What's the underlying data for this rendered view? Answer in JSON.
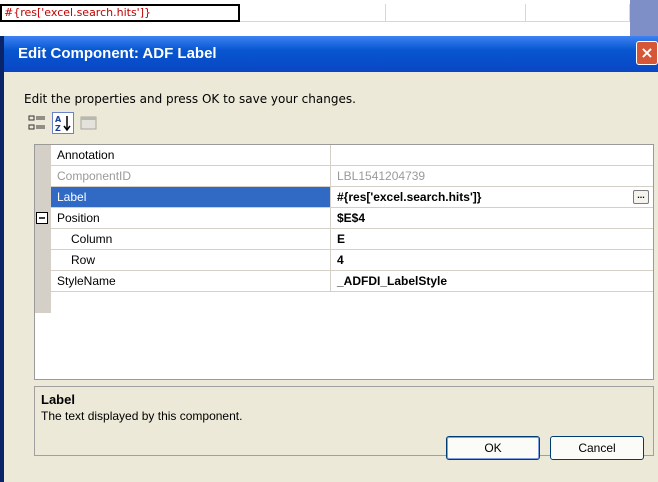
{
  "spreadsheet": {
    "active_cell_text": "#{res['excel.search.hits']}"
  },
  "dialog": {
    "title": "Edit Component: ADF Label",
    "instructions": "Edit the properties and press OK to save your changes.",
    "properties": [
      {
        "name": "Annotation",
        "value": ""
      },
      {
        "name": "ComponentID",
        "value": "LBL1541204739"
      },
      {
        "name": "Label",
        "value": "#{res['excel.search.hits']}"
      },
      {
        "name": "Position",
        "value": "$E$4"
      },
      {
        "name": "Column",
        "value": "E"
      },
      {
        "name": "Row",
        "value": "4"
      },
      {
        "name": "StyleName",
        "value": "_ADFDI_LabelStyle"
      }
    ],
    "ellipsis_label": "...",
    "expander_symbol": "−",
    "description": {
      "title": "Label",
      "text": "The text displayed by this component."
    },
    "ok_label": "OK",
    "cancel_label": "Cancel",
    "close_symbol": "×"
  },
  "colors": {
    "title_bar": "#0a46c4",
    "selection": "#316ac5",
    "dialog_bg": "#ece9d8"
  }
}
